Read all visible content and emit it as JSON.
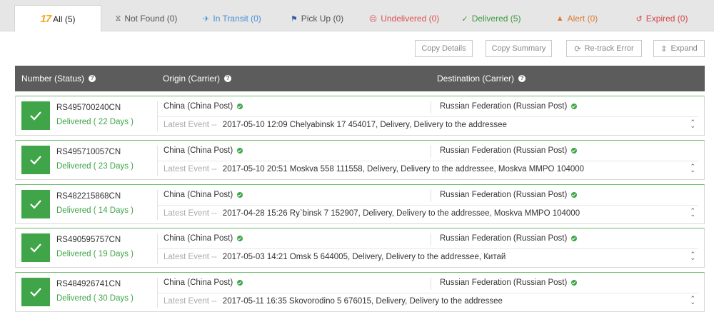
{
  "tabs": [
    {
      "brand": "17",
      "label": "All (5)",
      "icon": "17track-logo-icon",
      "active": true
    },
    {
      "label": "Not Found (0)",
      "icon": "hourglass-icon"
    },
    {
      "label": "In Transit (0)",
      "icon": "airplane-icon"
    },
    {
      "label": "Pick Up (0)",
      "icon": "flag-icon"
    },
    {
      "label": "Undelivered (0)",
      "icon": "sad-face-icon"
    },
    {
      "label": "Delivered (5)",
      "icon": "check-icon"
    },
    {
      "label": "Alert (0)",
      "icon": "warning-icon"
    },
    {
      "label": "Expired (0)",
      "icon": "history-icon"
    }
  ],
  "toolbar": {
    "copy_details": "Copy Details",
    "copy_summary": "Copy Summary",
    "retrack": "Re-track Error",
    "expand": "Expand"
  },
  "table": {
    "headers": [
      "Number (Status)",
      "Origin (Carrier)",
      "Destination (Carrier)"
    ],
    "event_label": "Latest Event --",
    "rows": [
      {
        "number": "RS495700240CN",
        "status": "Delivered ( 22 Days )",
        "origin": "China (China Post)",
        "destination": "Russian Federation (Russian Post)",
        "event": "2017-05-10 12:09 Chelyabinsk 17 454017, Delivery, Delivery to the addressee"
      },
      {
        "number": "RS495710057CN",
        "status": "Delivered ( 23 Days )",
        "origin": "China (China Post)",
        "destination": "Russian Federation (Russian Post)",
        "event": "2017-05-10 20:51 Moskva 558 111558, Delivery, Delivery to the addressee, Moskva MMPO 104000"
      },
      {
        "number": "RS482215868CN",
        "status": "Delivered ( 14 Days )",
        "origin": "China (China Post)",
        "destination": "Russian Federation (Russian Post)",
        "event": "2017-04-28 15:26 Ry`binsk 7 152907, Delivery, Delivery to the addressee, Moskva MMPO 104000"
      },
      {
        "number": "RS490595757CN",
        "status": "Delivered ( 19 Days )",
        "origin": "China (China Post)",
        "destination": "Russian Federation (Russian Post)",
        "event": "2017-05-03 14:21 Omsk 5 644005, Delivery, Delivery to the addressee, Китай"
      },
      {
        "number": "RS484926741CN",
        "status": "Delivered ( 30 Days )",
        "origin": "China (China Post)",
        "destination": "Russian Federation (Russian Post)",
        "event": "2017-05-11 16:35 Skovorodino 5 676015, Delivery, Delivery to the addressee"
      }
    ]
  },
  "colors": {
    "delivered_green": "#3fa548",
    "header_bg": "#5c5c5c",
    "brand_orange": "#f5a623"
  }
}
